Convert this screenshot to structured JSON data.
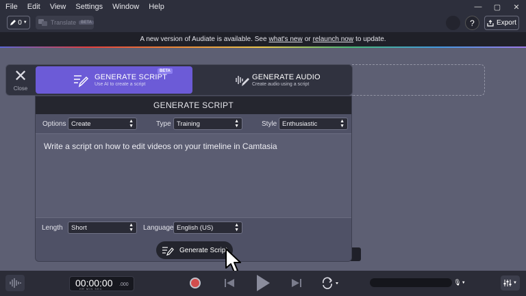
{
  "menu": {
    "items": [
      "File",
      "Edit",
      "View",
      "Settings",
      "Window",
      "Help"
    ]
  },
  "window_controls": {
    "minimize": "—",
    "maximize": "▢",
    "close": "✕"
  },
  "toolbar": {
    "pen_count": "0",
    "translate_label": "Translate",
    "translate_badge": "BETA",
    "help": "?",
    "export_label": "Export"
  },
  "banner": {
    "prefix": "A new version of Audiate is available. See",
    "link1": "what's new",
    "middle": "or",
    "link2": "relaunch now",
    "suffix": "to update."
  },
  "panel": {
    "close_label": "Close",
    "tab_script_title": "GENERATE SCRIPT",
    "tab_script_sub": "Use AI to create a script",
    "tab_script_badge": "BETA",
    "tab_audio_title": "GENERATE AUDIO",
    "tab_audio_sub": "Create audio using a script"
  },
  "card": {
    "title": "GENERATE SCRIPT",
    "options_label": "Options",
    "options_value": "Create",
    "type_label": "Type",
    "type_value": "Training",
    "style_label": "Style",
    "style_value": "Enthusiastic",
    "prompt": "Write a script on how to edit videos on your timeline in Camtasia",
    "length_label": "Length",
    "length_value": "Short",
    "language_label": "Language",
    "language_value": "English (US)",
    "generate_button": "Generate Script"
  },
  "playbar": {
    "timecode": "00:00:00",
    "ms": ".000",
    "units": "HR  MIN  SEC"
  },
  "colors": {
    "accent": "#6c5bd7",
    "record": "#d24d4d"
  }
}
